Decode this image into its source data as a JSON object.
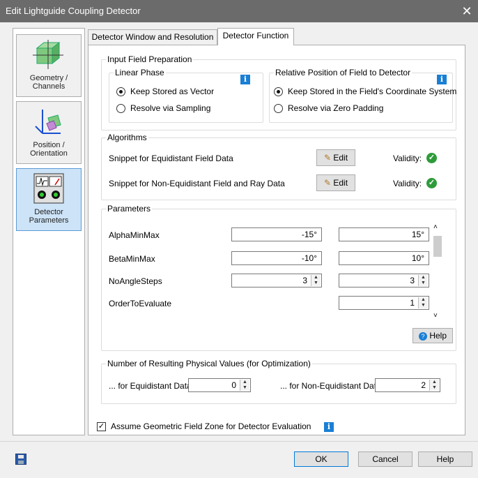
{
  "window": {
    "title": "Edit Lightguide Coupling Detector",
    "close_icon": "close-icon"
  },
  "nav": {
    "items": [
      {
        "label_line1": "Geometry /",
        "label_line2": "Channels",
        "icon": "geometry-channels-icon",
        "selected": false
      },
      {
        "label_line1": "Position /",
        "label_line2": "Orientation",
        "icon": "position-orientation-icon",
        "selected": false
      },
      {
        "label_line1": "Detector",
        "label_line2": "Parameters",
        "icon": "detector-parameters-icon",
        "selected": true
      }
    ]
  },
  "tabs": [
    {
      "label": "Detector Window and Resolution",
      "active": false
    },
    {
      "label": "Detector Function",
      "active": true
    }
  ],
  "input_field_prep": {
    "title": "Input Field Preparation",
    "linear_phase": {
      "title": "Linear Phase",
      "options": [
        "Keep Stored as Vector",
        "Resolve via Sampling"
      ],
      "selected": 0
    },
    "relative_position": {
      "title": "Relative Position of Field to Detector",
      "options": [
        "Keep Stored in the Field's Coordinate System",
        "Resolve via Zero Padding"
      ],
      "selected": 0
    },
    "info_glyph": "i"
  },
  "algorithms": {
    "title": "Algorithms",
    "rows": [
      {
        "label": "Snippet for Equidistant Field Data",
        "edit_label": "Edit",
        "validity_label": "Validity:",
        "valid": true
      },
      {
        "label": "Snippet for Non-Equidistant Field and Ray Data",
        "edit_label": "Edit",
        "validity_label": "Validity:",
        "valid": true
      }
    ]
  },
  "parameters": {
    "title": "Parameters",
    "rows": [
      {
        "name": "AlphaMinMax",
        "min": "-15°",
        "max": "15°"
      },
      {
        "name": "BetaMinMax",
        "min": "-10°",
        "max": "10°"
      },
      {
        "name": "NoAngleSteps",
        "min": "3",
        "max": "3"
      },
      {
        "name": "OrderToEvaluate",
        "min": "",
        "max": "1"
      }
    ],
    "help_label": "Help"
  },
  "resulting_values": {
    "title": "Number of Resulting Physical Values (for Optimization)",
    "equidistant_label": "... for Equidistant Data",
    "equidistant_value": "0",
    "non_equidistant_label": "... for Non-Equidistant Data",
    "non_equidistant_value": "2"
  },
  "assume_geometric": {
    "label": "Assume Geometric Field Zone for Detector Evaluation",
    "checked": true
  },
  "footer": {
    "ok_label": "OK",
    "cancel_label": "Cancel",
    "help_label": "Help",
    "save_icon": "save-icon"
  },
  "colors": {
    "titlebar": "#6b6b6b",
    "accent": "#1a7fd4",
    "valid": "#2e9b3a",
    "selection": "#cde3f7"
  }
}
